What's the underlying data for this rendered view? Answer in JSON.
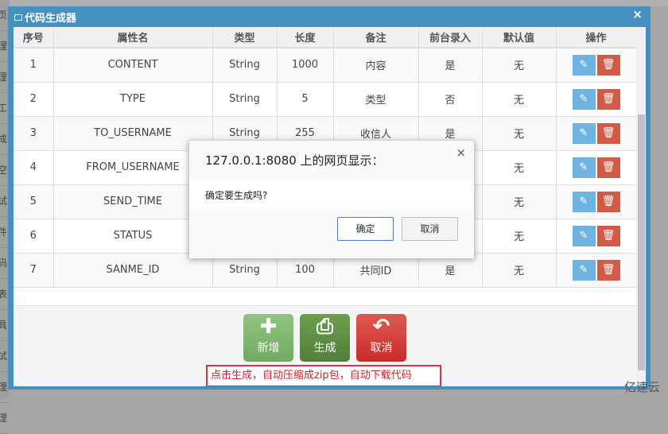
{
  "background_sidebar": [
    "页",
    "理",
    "理",
    "工具",
    "成",
    "空",
    "试",
    "件",
    "码",
    "表",
    "具",
    "试",
    "理",
    "理"
  ],
  "modal": {
    "title": "代码生成器",
    "close": "×"
  },
  "table": {
    "headers": [
      "序号",
      "属性名",
      "类型",
      "长度",
      "备注",
      "前台录入",
      "默认值",
      "操作"
    ],
    "rows": [
      [
        "1",
        "CONTENT",
        "String",
        "1000",
        "内容",
        "是",
        "无"
      ],
      [
        "2",
        "TYPE",
        "String",
        "5",
        "类型",
        "否",
        "无"
      ],
      [
        "3",
        "TO_USERNAME",
        "String",
        "255",
        "收信人",
        "是",
        "无"
      ],
      [
        "4",
        "FROM_USERNAME",
        "",
        "",
        "",
        "",
        "无"
      ],
      [
        "5",
        "SEND_TIME",
        "",
        "",
        "",
        "",
        "无"
      ],
      [
        "6",
        "STATUS",
        "",
        "",
        "",
        "",
        "无"
      ],
      [
        "7",
        "SANME_ID",
        "String",
        "100",
        "共同ID",
        "是",
        "无"
      ]
    ]
  },
  "buttons": {
    "add": "新增",
    "generate": "生成",
    "cancel": "取消"
  },
  "note": "点击生成，自动压缩成zip包，自动下载代码",
  "dialog": {
    "title": "127.0.0.1:8080 上的网页显示：",
    "message": "确定要生成吗?",
    "ok": "确定",
    "cancel": "取消",
    "close": "×"
  },
  "watermark": "亿速云",
  "colors": {
    "modal": "#4590c0",
    "add": "#87b87f",
    "generate": "#629b58",
    "cancel": "#d15b47",
    "edit": "#6fb3e0"
  }
}
